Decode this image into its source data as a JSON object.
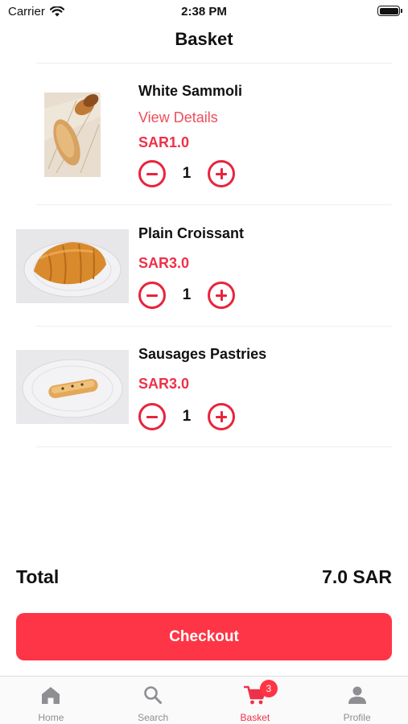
{
  "status_bar": {
    "carrier": "Carrier",
    "time": "2:38 PM"
  },
  "title": "Basket",
  "items": [
    {
      "name": "White Sammoli",
      "link": "View Details",
      "price": "SAR1.0",
      "quantity": "1",
      "image": "bread-rolls-on-cloth"
    },
    {
      "name": "Plain Croissant",
      "price": "SAR3.0",
      "quantity": "1",
      "image": "croissant-on-glass-plate"
    },
    {
      "name": "Sausages Pastries",
      "price": "SAR3.0",
      "quantity": "1",
      "image": "sausage-pastry-on-glass-plate"
    }
  ],
  "total": {
    "label": "Total",
    "value": "7.0 SAR"
  },
  "checkout_label": "Checkout",
  "tabs": [
    {
      "label": "Home",
      "icon": "home-icon"
    },
    {
      "label": "Search",
      "icon": "search-icon"
    },
    {
      "label": "Basket",
      "icon": "cart-icon",
      "badge": "3",
      "active": true
    },
    {
      "label": "Profile",
      "icon": "person-icon"
    }
  ],
  "colors": {
    "accent": "#fe3546",
    "price": "#ee3148",
    "link": "#ee4d5a",
    "inactive": "#8e8e93"
  }
}
